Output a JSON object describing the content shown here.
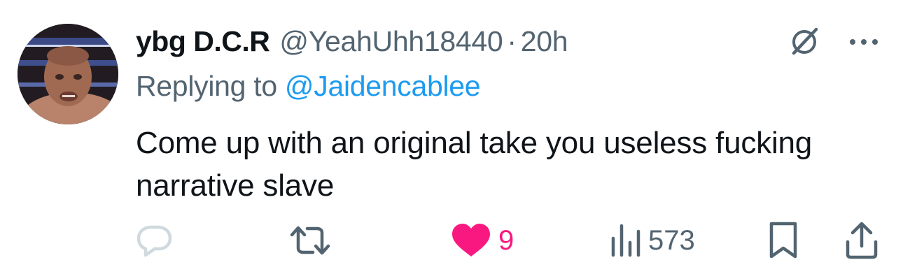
{
  "tweet": {
    "display_name": "ybg D.C.R",
    "handle": "@YeahUhh18440",
    "separator": "·",
    "time": "20h",
    "replying_prefix": "Replying to ",
    "replying_to": "@Jaidencablee",
    "text": "Come up with an original take you useless fucking narrative slave"
  },
  "actions": {
    "reply_icon": "reply-icon",
    "retweet_icon": "retweet-icon",
    "like_icon": "heart-filled-icon",
    "like_count": "9",
    "views_icon": "views-bar-chart-icon",
    "views_count": "573",
    "bookmark_icon": "bookmark-icon",
    "share_icon": "share-icon"
  },
  "header_icons": {
    "grok": "grok-icon",
    "more": "more-dots-icon"
  },
  "colors": {
    "text": "#0f1419",
    "secondary": "#536471",
    "link": "#1d9bf0",
    "like": "#f91880",
    "reply_icon": "#cfd9de"
  }
}
